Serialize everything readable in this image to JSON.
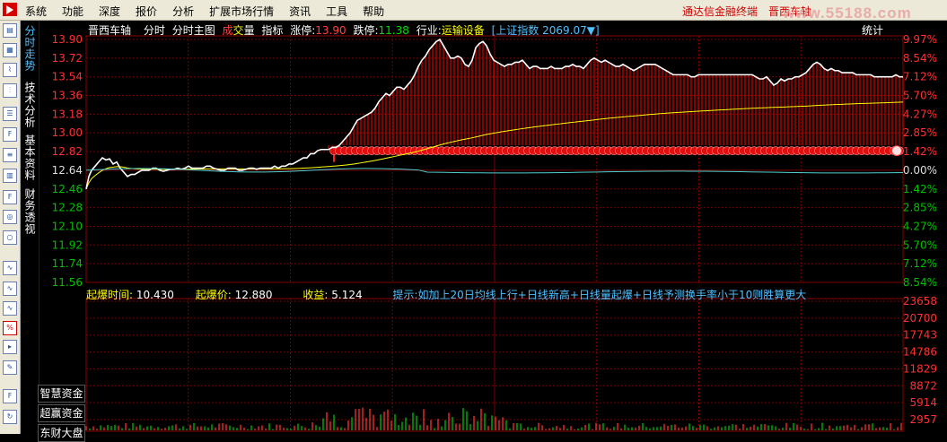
{
  "menu": [
    "系统",
    "功能",
    "深度",
    "报价",
    "分析",
    "扩展市场行情",
    "资讯",
    "工具",
    "帮助"
  ],
  "app_title": "通达信金融终端",
  "top_stock": "晋西车轴",
  "watermark": "www.55188.com",
  "vtabs": [
    "分时走势",
    "技术分析",
    "基本资料",
    "财务透视"
  ],
  "side_buttons": [
    "智慧资金",
    "超赢资金",
    "东财大盘"
  ],
  "info_bar": {
    "stock": "晋西车轴",
    "items": [
      "分时",
      "分时主图"
    ],
    "cheng": "成",
    "jiao": "交",
    "liang": "量",
    "zhibiao": "指标",
    "zhangting_label": "涨停:",
    "zhangting_value": "13.90",
    "dieting_label": "跌停:",
    "dieting_value": "11.38",
    "hangye_label": "行业:",
    "hangye_value": "运输设备",
    "index_label": "[上证指数",
    "index_value": "2069.07▼]",
    "tongji": "统计"
  },
  "indicator_bar": {
    "t_label": "起爆时间:",
    "t_value": "10.430",
    "p_label": "起爆价:",
    "p_value": "12.880",
    "r_label": "收益:",
    "r_value": "5.124",
    "hint": "提示:如加上20日均线上行+日线新高+日线量起爆+日线予测换手率小于10则胜算更大"
  },
  "colors": {
    "up": "#ff3030",
    "down": "#00c000",
    "price": "#ffffff",
    "avg": "#ffff00",
    "grid": "#8b0000",
    "cyan": "#4fd0d0"
  },
  "chart_data": {
    "type": "line",
    "price_axis": {
      "ticks": [
        "13.90",
        "13.72",
        "13.54",
        "13.36",
        "13.18",
        "13.00",
        "12.82",
        "12.64",
        "12.46",
        "12.28",
        "12.10",
        "11.92",
        "11.74",
        "11.56"
      ],
      "values": [
        13.9,
        13.72,
        13.54,
        13.36,
        13.18,
        13.0,
        12.82,
        12.64,
        12.46,
        12.28,
        12.1,
        11.92,
        11.74,
        11.56
      ],
      "pct": [
        "9.97%",
        "8.54%",
        "7.12%",
        "5.70%",
        "4.27%",
        "2.85%",
        "1.42%",
        "0.00%",
        "1.42%",
        "2.85%",
        "4.27%",
        "5.70%",
        "7.12%",
        "8.54%"
      ],
      "ylim": [
        11.56,
        13.9
      ],
      "prev_close": 12.64
    },
    "volume_axis": {
      "ticks": [
        "23658",
        "20700",
        "17743",
        "14786",
        "11829",
        "8872",
        "5914",
        "2957"
      ],
      "ylim": [
        0,
        23658
      ]
    },
    "series": [
      {
        "points": [
          [
            0,
            12.46
          ],
          [
            3,
            12.58
          ],
          [
            6,
            12.64
          ],
          [
            10,
            12.68
          ],
          [
            14,
            12.72
          ],
          [
            18,
            12.76
          ],
          [
            22,
            12.74
          ],
          [
            26,
            12.75
          ],
          [
            30,
            12.7
          ],
          [
            34,
            12.72
          ],
          [
            38,
            12.66
          ],
          [
            42,
            12.62
          ],
          [
            46,
            12.58
          ],
          [
            50,
            12.6
          ],
          [
            54,
            12.6
          ],
          [
            58,
            12.62
          ],
          [
            62,
            12.64
          ],
          [
            66,
            12.64
          ],
          [
            70,
            12.64
          ],
          [
            74,
            12.66
          ],
          [
            78,
            12.66
          ],
          [
            82,
            12.64
          ],
          [
            86,
            12.63
          ],
          [
            90,
            12.64
          ],
          [
            94,
            12.65
          ],
          [
            98,
            12.65
          ],
          [
            102,
            12.66
          ],
          [
            106,
            12.65
          ],
          [
            110,
            12.66
          ],
          [
            114,
            12.68
          ],
          [
            118,
            12.66
          ],
          [
            122,
            12.66
          ],
          [
            126,
            12.66
          ],
          [
            130,
            12.66
          ],
          [
            134,
            12.68
          ],
          [
            138,
            12.68
          ],
          [
            142,
            12.66
          ],
          [
            146,
            12.65
          ],
          [
            150,
            12.64
          ],
          [
            154,
            12.64
          ],
          [
            158,
            12.66
          ],
          [
            162,
            12.66
          ],
          [
            166,
            12.66
          ],
          [
            170,
            12.64
          ],
          [
            174,
            12.64
          ],
          [
            178,
            12.65
          ],
          [
            182,
            12.66
          ],
          [
            186,
            12.66
          ],
          [
            190,
            12.65
          ],
          [
            194,
            12.66
          ],
          [
            198,
            12.66
          ],
          [
            202,
            12.66
          ],
          [
            206,
            12.66
          ],
          [
            210,
            12.68
          ],
          [
            214,
            12.66
          ],
          [
            218,
            12.68
          ],
          [
            222,
            12.68
          ],
          [
            226,
            12.7
          ],
          [
            230,
            12.7
          ],
          [
            234,
            12.72
          ],
          [
            238,
            12.74
          ],
          [
            242,
            12.76
          ],
          [
            246,
            12.76
          ],
          [
            250,
            12.8
          ],
          [
            254,
            12.8
          ],
          [
            258,
            12.83
          ],
          [
            262,
            12.84
          ],
          [
            266,
            12.84
          ],
          [
            270,
            12.84
          ],
          [
            274,
            12.86
          ],
          [
            278,
            12.86
          ],
          [
            282,
            12.88
          ],
          [
            286,
            12.92
          ],
          [
            290,
            12.96
          ],
          [
            294,
            13.0
          ],
          [
            298,
            13.06
          ],
          [
            302,
            13.12
          ],
          [
            306,
            13.14
          ],
          [
            310,
            13.16
          ],
          [
            314,
            13.18
          ],
          [
            318,
            13.2
          ],
          [
            322,
            13.24
          ],
          [
            326,
            13.3
          ],
          [
            330,
            13.34
          ],
          [
            334,
            13.38
          ],
          [
            338,
            13.36
          ],
          [
            342,
            13.4
          ],
          [
            346,
            13.44
          ],
          [
            350,
            13.44
          ],
          [
            354,
            13.42
          ],
          [
            358,
            13.46
          ],
          [
            362,
            13.5
          ],
          [
            366,
            13.56
          ],
          [
            370,
            13.64
          ],
          [
            374,
            13.7
          ],
          [
            378,
            13.74
          ],
          [
            382,
            13.8
          ],
          [
            386,
            13.84
          ],
          [
            390,
            13.88
          ],
          [
            394,
            13.9
          ],
          [
            398,
            13.84
          ],
          [
            402,
            13.78
          ],
          [
            406,
            13.72
          ],
          [
            410,
            13.72
          ],
          [
            414,
            13.74
          ],
          [
            418,
            13.72
          ],
          [
            422,
            13.66
          ],
          [
            426,
            13.64
          ],
          [
            430,
            13.7
          ],
          [
            434,
            13.82
          ],
          [
            438,
            13.86
          ],
          [
            442,
            13.88
          ],
          [
            446,
            13.84
          ],
          [
            450,
            13.76
          ],
          [
            454,
            13.7
          ],
          [
            458,
            13.68
          ],
          [
            462,
            13.66
          ],
          [
            466,
            13.64
          ],
          [
            470,
            13.66
          ],
          [
            474,
            13.66
          ],
          [
            478,
            13.68
          ],
          [
            482,
            13.68
          ],
          [
            486,
            13.7
          ],
          [
            490,
            13.66
          ],
          [
            494,
            13.62
          ],
          [
            498,
            13.64
          ],
          [
            502,
            13.64
          ],
          [
            506,
            13.62
          ],
          [
            510,
            13.62
          ],
          [
            514,
            13.62
          ],
          [
            518,
            13.64
          ],
          [
            522,
            13.62
          ],
          [
            526,
            13.62
          ],
          [
            530,
            13.62
          ],
          [
            534,
            13.64
          ],
          [
            538,
            13.64
          ],
          [
            542,
            13.66
          ],
          [
            546,
            13.64
          ],
          [
            550,
            13.64
          ],
          [
            554,
            13.62
          ],
          [
            558,
            13.66
          ],
          [
            562,
            13.7
          ],
          [
            566,
            13.72
          ],
          [
            570,
            13.7
          ],
          [
            574,
            13.68
          ],
          [
            578,
            13.7
          ],
          [
            582,
            13.68
          ],
          [
            586,
            13.66
          ],
          [
            590,
            13.64
          ],
          [
            594,
            13.64
          ],
          [
            598,
            13.66
          ],
          [
            602,
            13.64
          ],
          [
            606,
            13.62
          ],
          [
            610,
            13.6
          ],
          [
            614,
            13.62
          ],
          [
            618,
            13.64
          ],
          [
            622,
            13.66
          ],
          [
            626,
            13.66
          ],
          [
            630,
            13.66
          ],
          [
            634,
            13.66
          ],
          [
            638,
            13.64
          ],
          [
            642,
            13.62
          ],
          [
            646,
            13.6
          ],
          [
            650,
            13.58
          ],
          [
            654,
            13.56
          ],
          [
            658,
            13.56
          ],
          [
            662,
            13.56
          ],
          [
            666,
            13.56
          ],
          [
            670,
            13.56
          ],
          [
            674,
            13.54
          ],
          [
            678,
            13.54
          ],
          [
            682,
            13.56
          ],
          [
            686,
            13.56
          ],
          [
            690,
            13.56
          ],
          [
            694,
            13.56
          ],
          [
            698,
            13.56
          ],
          [
            702,
            13.56
          ],
          [
            706,
            13.56
          ],
          [
            710,
            13.56
          ],
          [
            714,
            13.56
          ],
          [
            718,
            13.56
          ],
          [
            722,
            13.56
          ],
          [
            726,
            13.56
          ],
          [
            730,
            13.56
          ],
          [
            734,
            13.56
          ],
          [
            738,
            13.56
          ],
          [
            742,
            13.56
          ],
          [
            746,
            13.54
          ],
          [
            750,
            13.52
          ],
          [
            754,
            13.52
          ],
          [
            758,
            13.54
          ],
          [
            762,
            13.5
          ],
          [
            766,
            13.46
          ],
          [
            770,
            13.48
          ],
          [
            774,
            13.52
          ],
          [
            778,
            13.5
          ],
          [
            782,
            13.52
          ],
          [
            786,
            13.52
          ],
          [
            790,
            13.54
          ],
          [
            794,
            13.54
          ],
          [
            798,
            13.56
          ],
          [
            802,
            13.58
          ],
          [
            806,
            13.62
          ],
          [
            810,
            13.66
          ],
          [
            814,
            13.68
          ],
          [
            818,
            13.66
          ],
          [
            822,
            13.62
          ],
          [
            826,
            13.6
          ],
          [
            830,
            13.62
          ],
          [
            834,
            13.6
          ],
          [
            838,
            13.6
          ],
          [
            842,
            13.58
          ],
          [
            846,
            13.58
          ],
          [
            850,
            13.58
          ],
          [
            854,
            13.58
          ],
          [
            858,
            13.56
          ],
          [
            862,
            13.56
          ],
          [
            866,
            13.56
          ],
          [
            870,
            13.56
          ],
          [
            874,
            13.56
          ],
          [
            878,
            13.54
          ],
          [
            882,
            13.54
          ],
          [
            886,
            13.54
          ],
          [
            890,
            13.54
          ],
          [
            894,
            13.54
          ],
          [
            898,
            13.54
          ],
          [
            902,
            13.56
          ],
          [
            906,
            13.54
          ],
          [
            910,
            13.54
          ]
        ]
      }
    ],
    "avg_line_end": 13.54,
    "signal_price": 12.88,
    "volume_note": "volume bars at bottom; spikes near 10:00"
  }
}
